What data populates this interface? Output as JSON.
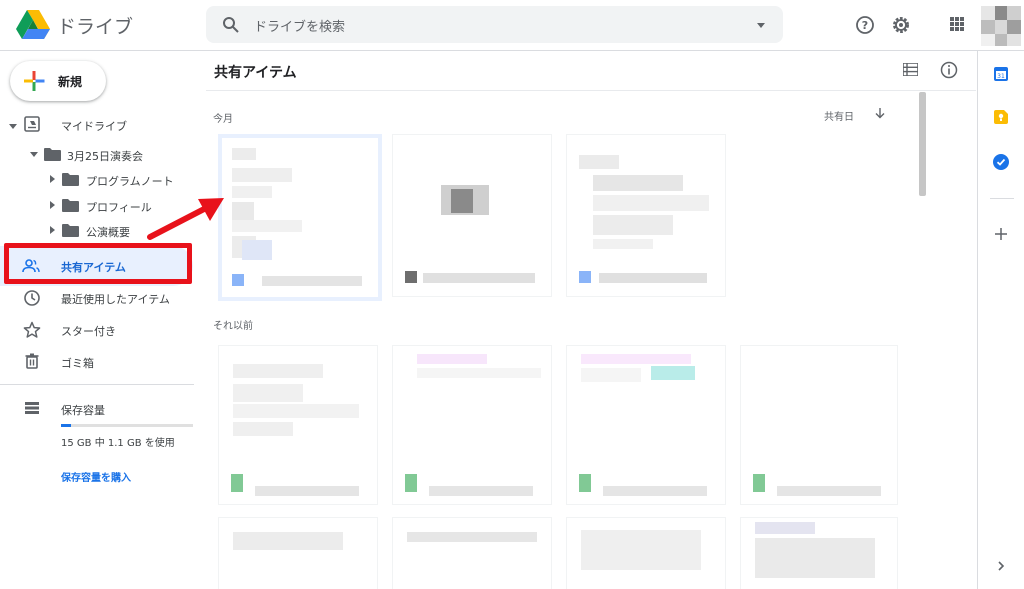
{
  "app": {
    "brand": "ドライブ"
  },
  "search": {
    "placeholder": "ドライブを検索"
  },
  "header_icons": [
    "help-icon",
    "settings-icon",
    "apps-icon",
    "account-avatar"
  ],
  "sidebar": {
    "new_label": "新規",
    "my_drive": "マイドライブ",
    "folder_main": "3月25日演奏会",
    "subfolders": [
      "プログラムノート",
      "プロフィール",
      "公演概要"
    ],
    "shared": "共有アイテム",
    "recent": "最近使用したアイテム",
    "starred": "スター付き",
    "trash": "ゴミ箱",
    "storage_label": "保存容量",
    "storage_usage": "15 GB 中 1.1 GB を使用",
    "storage_fraction": 0.073,
    "buy_storage": "保存容量を購入"
  },
  "main": {
    "title": "共有アイテム",
    "section_recent": "今月",
    "section_older": "それ以前",
    "sort_label": "共有日"
  },
  "colors": {
    "accent": "#1a73e8",
    "highlight": "#e8f0fe",
    "annotation_red": "#e8121b"
  }
}
